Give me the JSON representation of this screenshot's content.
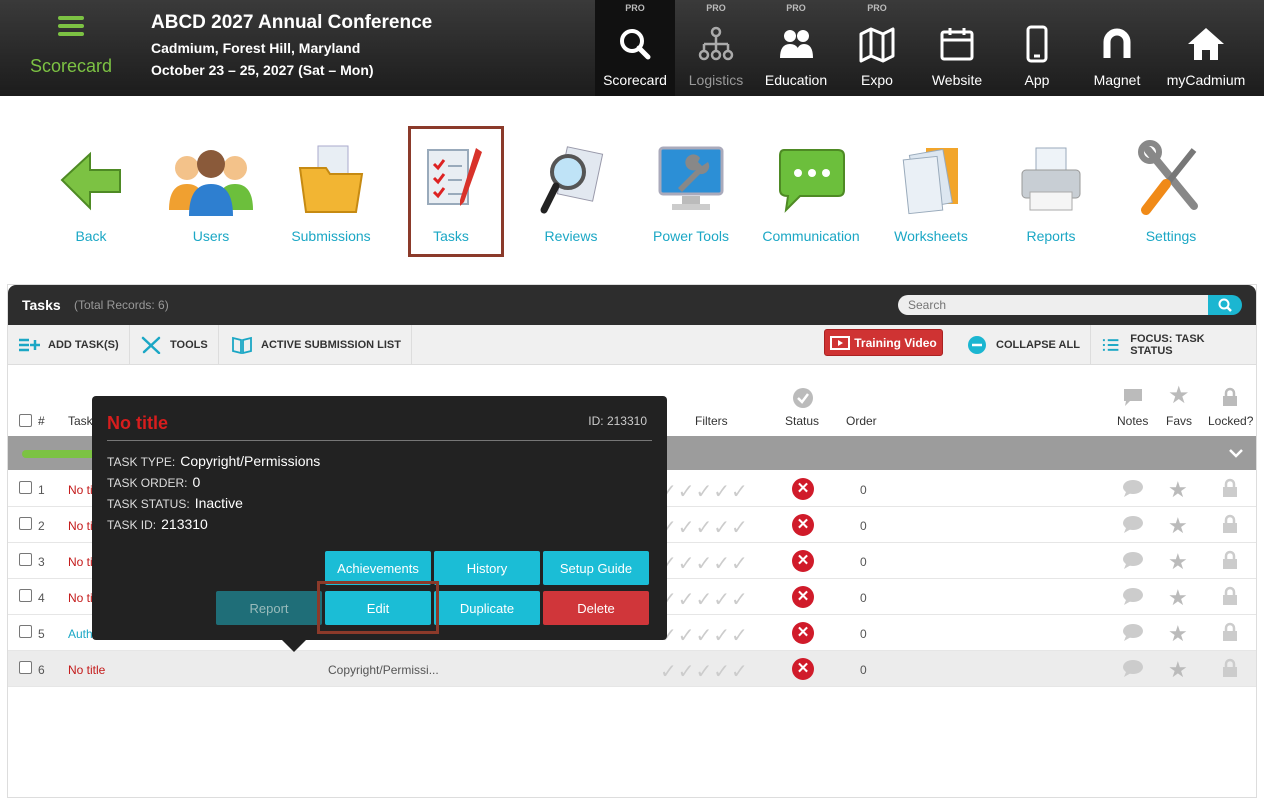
{
  "brand": {
    "label": "Scorecard"
  },
  "conference": {
    "title": "ABCD 2027 Annual Conference",
    "location": "Cadmium, Forest Hill, Maryland",
    "dates": "October 23 – 25, 2027 (Sat – Mon)"
  },
  "topnav": [
    {
      "label": "Scorecard",
      "pro": "PRO",
      "icon": "search-icon"
    },
    {
      "label": "Logistics",
      "pro": "PRO",
      "icon": "org-chart-icon"
    },
    {
      "label": "Education",
      "pro": "PRO",
      "icon": "people-icon"
    },
    {
      "label": "Expo",
      "pro": "PRO",
      "icon": "map-icon"
    },
    {
      "label": "Website",
      "pro": "",
      "icon": "calendar-icon"
    },
    {
      "label": "App",
      "pro": "",
      "icon": "phone-icon"
    },
    {
      "label": "Magnet",
      "pro": "",
      "icon": "magnet-icon"
    },
    {
      "label": "myCadmium",
      "pro": "",
      "icon": "home-icon"
    }
  ],
  "iconbar": [
    {
      "label": "Back"
    },
    {
      "label": "Users"
    },
    {
      "label": "Submissions"
    },
    {
      "label": "Tasks"
    },
    {
      "label": "Reviews"
    },
    {
      "label": "Power Tools"
    },
    {
      "label": "Communication"
    },
    {
      "label": "Worksheets"
    },
    {
      "label": "Reports"
    },
    {
      "label": "Settings"
    }
  ],
  "panel": {
    "title": "Tasks",
    "count": "(Total Records: 6)",
    "search_placeholder": "Search"
  },
  "toolbar": {
    "add": "ADD TASK(S)",
    "tools": "TOOLS",
    "active_list": "ACTIVE SUBMISSION LIST",
    "training": "Training Video",
    "collapse": "COLLAPSE ALL",
    "focus": "FOCUS: TASK STATUS"
  },
  "columns": {
    "num": "#",
    "task": "Task",
    "filters": "Filters",
    "status": "Status",
    "order": "Order",
    "notes": "Notes",
    "favs": "Favs",
    "locked": "Locked?"
  },
  "rows": [
    {
      "num": "1",
      "title": "No title",
      "type": "",
      "order": "0"
    },
    {
      "num": "2",
      "title": "No title",
      "type": "",
      "order": "0"
    },
    {
      "num": "3",
      "title": "No title",
      "type": "",
      "order": "0"
    },
    {
      "num": "4",
      "title": "No title",
      "type": "",
      "order": "0"
    },
    {
      "num": "5",
      "title": "Authors",
      "type": "",
      "order": "0"
    },
    {
      "num": "6",
      "title": "No title",
      "type": "Copyright/Permissi...",
      "order": "0"
    }
  ],
  "popup": {
    "title": "No title",
    "id": "ID: 213310",
    "type_label": "TASK TYPE:",
    "type_value": "Copyright/Permissions",
    "order_label": "TASK ORDER:",
    "order_value": "0",
    "status_label": "TASK STATUS:",
    "status_value": "Inactive",
    "id_label": "TASK ID:",
    "id_value": "213310",
    "buttons": {
      "achievements": "Achievements",
      "history": "History",
      "setup_guide": "Setup Guide",
      "report": "Report",
      "edit": "Edit",
      "duplicate": "Duplicate",
      "delete": "Delete"
    }
  },
  "colors": {
    "accent": "#1bb6d1",
    "brand_green": "#7cc243",
    "danger": "#d0363a"
  }
}
